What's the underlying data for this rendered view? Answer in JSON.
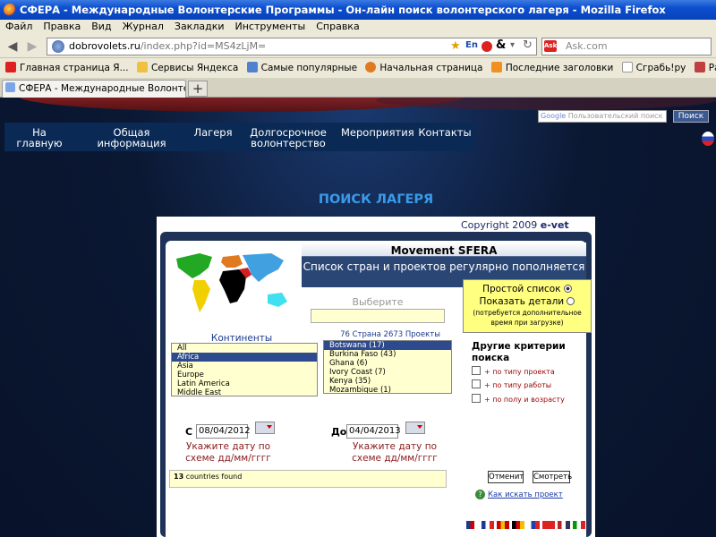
{
  "window": {
    "title": "СФЕРА - Международные Волонтерские Программы - Он-лайн поиск волонтерского лагеря - Mozilla Firefox"
  },
  "menu": [
    "Файл",
    "Правка",
    "Вид",
    "Журнал",
    "Закладки",
    "Инструменты",
    "Справка"
  ],
  "url": {
    "domain": "dobrovolets.ru",
    "path": "/index.php?id=MS4zLjM="
  },
  "search": {
    "placeholder": "Ask.com",
    "engine_icon": "Ask"
  },
  "bookmarks": [
    {
      "label": "Главная страница Я...",
      "icon": "yandex-icon",
      "color": "#e02020"
    },
    {
      "label": "Сервисы Яндекса",
      "icon": "folder-icon",
      "color": "#f0c040"
    },
    {
      "label": "Самые популярные",
      "icon": "star-icon",
      "color": "#5080d0"
    },
    {
      "label": "Начальная страница",
      "icon": "firefox-icon",
      "color": "#e07a20"
    },
    {
      "label": "Последние заголовки",
      "icon": "rss-icon",
      "color": "#f09020"
    },
    {
      "label": "Сграбь!ру",
      "icon": "page-icon",
      "color": "#ffffff"
    },
    {
      "label": "Расписание электри...",
      "icon": "tools-icon",
      "color": "#c04040"
    }
  ],
  "tab": {
    "label": "СФЕРА - Международные Волонтерские П...",
    "new_tab": "+"
  },
  "site_nav": [
    {
      "label": "На главную"
    },
    {
      "label": "Общая информация"
    },
    {
      "label": "Лагеря"
    },
    {
      "label": "Долгосрочное волонтерство"
    },
    {
      "label": "Мероприятия"
    },
    {
      "label": "Контакты"
    }
  ],
  "google": {
    "logo": "Google",
    "placeholder": "Пользовательский поиск",
    "button": "Поиск"
  },
  "page_heading": "ПОИСК ЛАГЕРЯ",
  "copyright": {
    "text": "Copyright 2009",
    "brand": "e-vet"
  },
  "banner": {
    "title": "Movement SFERA",
    "subtitle": "Список стран и проектов регулярно пополняется"
  },
  "view_options": {
    "simple": "Простой список",
    "details": "Показать детали",
    "note": "(потребуется дополнительное время при загрузке)",
    "selected": "simple"
  },
  "choose_label": "Выберите",
  "continents": {
    "label": "Континенты",
    "items": [
      "All",
      "Africa",
      "Asia",
      "Europe",
      "Latin America",
      "Middle East"
    ],
    "selected": "Africa"
  },
  "countries": {
    "summary": "76 Страна 2673 Проекты",
    "items": [
      "Botswana (17)",
      "Burkina Faso (43)",
      "Ghana (6)",
      "Ivory Coast (7)",
      "Kenya (35)",
      "Mozambique (1)"
    ],
    "selected": "Botswana (17)"
  },
  "other_criteria": {
    "label": "Другие критерии поиска",
    "items": [
      "+ по типу проекта",
      "+ по типу работы",
      "+ по полу и возрасту"
    ]
  },
  "date_from": {
    "label": "С",
    "value": "08/04/2012",
    "hint": "Укажите дату по схеме дд/мм/гггг"
  },
  "date_to": {
    "label": "До",
    "value": "04/04/2013",
    "hint": "Укажите дату по схеме дд/мм/гггг"
  },
  "result": {
    "count": "13",
    "text": "countries found"
  },
  "buttons": {
    "reset": "Отменит",
    "view": "Смотреть"
  },
  "help_link": "Как искать проект",
  "languages": [
    {
      "name": "english-flag-icon",
      "colors": [
        "#1a3a8a",
        "#c00",
        "#fff"
      ]
    },
    {
      "name": "french-flag-icon",
      "colors": [
        "#1a3a9a",
        "#fff",
        "#d22"
      ]
    },
    {
      "name": "spanish-flag-icon",
      "colors": [
        "#c00",
        "#f0c000",
        "#c00"
      ]
    },
    {
      "name": "german-flag-icon",
      "colors": [
        "#000",
        "#d00",
        "#f0c000"
      ]
    },
    {
      "name": "russian-flag-icon",
      "colors": [
        "#fff",
        "#2040b0",
        "#d22"
      ]
    },
    {
      "name": "turkish-flag-icon",
      "colors": [
        "#d22",
        "#d22",
        "#d22"
      ]
    },
    {
      "name": "usa-flag-icon",
      "colors": [
        "#b22",
        "#fff",
        "#335"
      ]
    },
    {
      "name": "italian-flag-icon",
      "colors": [
        "#090",
        "#fff",
        "#d22"
      ]
    }
  ]
}
